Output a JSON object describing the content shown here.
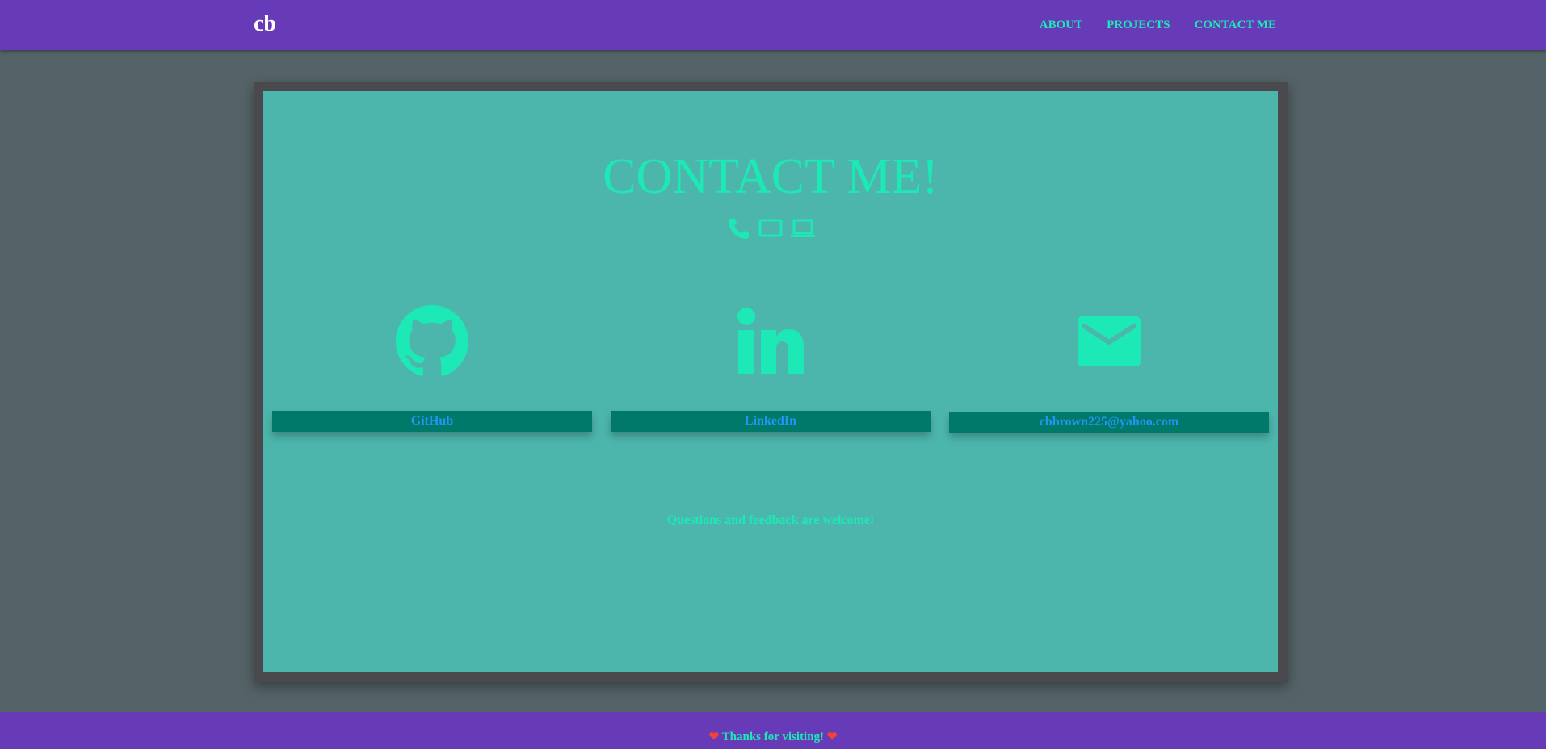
{
  "header": {
    "brand": "cb",
    "nav": [
      {
        "label": "ABOUT"
      },
      {
        "label": "PROJECTS"
      },
      {
        "label": "CONTACT ME"
      }
    ]
  },
  "main": {
    "title": "CONTACT ME!",
    "device_icons": [
      "phone-icon",
      "tablet-icon",
      "laptop-icon"
    ],
    "contacts": [
      {
        "label": "GitHub",
        "icon": "github-icon"
      },
      {
        "label": "LinkedIn",
        "icon": "linkedin-icon"
      },
      {
        "label": "cbbrown225@yahoo.com",
        "icon": "mail-icon"
      }
    ],
    "tagline": "Questions and feedback are welcome!"
  },
  "footer": {
    "text": "Thanks for visiting!",
    "icon": "heart-icon"
  },
  "colors": {
    "navbar": "#673ab7",
    "accent": "#1de9b6",
    "panel": "#4db6ac",
    "button_bg": "#00796b",
    "button_text": "#2196f3",
    "page_bg": "#546367",
    "heart": "#f44336"
  }
}
